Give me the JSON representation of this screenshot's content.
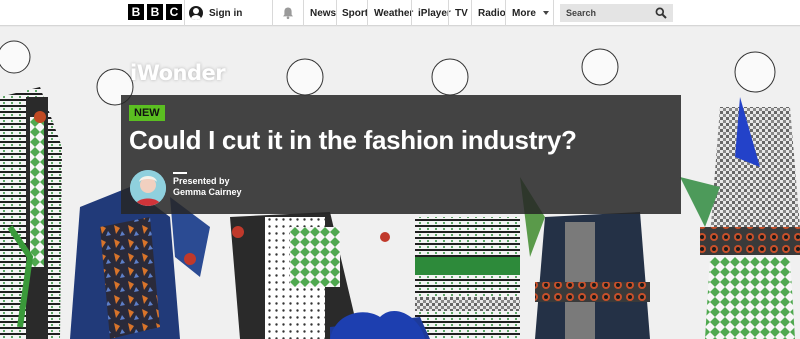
{
  "header": {
    "logo_letters": [
      "B",
      "B",
      "C"
    ],
    "sign_in_label": "Sign in",
    "notifications_icon": "bell-icon",
    "nav": [
      "News",
      "Sport",
      "Weather",
      "iPlayer",
      "TV",
      "Radio",
      "More"
    ],
    "more_icon": "caret-down-icon",
    "search_placeholder": "Search",
    "search_icon": "magnifier-icon"
  },
  "hero": {
    "brand": "iWonder",
    "badge": "NEW",
    "title": "Could I cut it in the fashion industry?",
    "presented_by_label": "Presented by",
    "presenter_name": "Gemma Cairney",
    "colors": {
      "badge": "#5bbf21",
      "panel": "#262626"
    }
  }
}
